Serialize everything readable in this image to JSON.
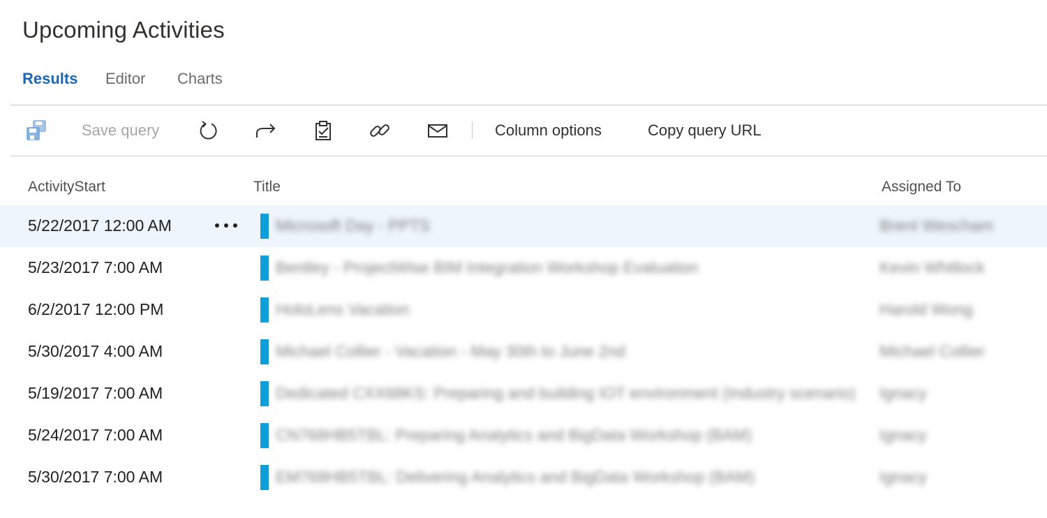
{
  "page": {
    "title": "Upcoming Activities"
  },
  "tabs": [
    {
      "label": "Results",
      "active": true
    },
    {
      "label": "Editor",
      "active": false
    },
    {
      "label": "Charts",
      "active": false
    }
  ],
  "toolbar": {
    "save_icon": "save-query-icon",
    "save_query_label": "Save query",
    "refresh_icon": "refresh-icon",
    "forward_icon": "forward-icon",
    "clipboard_icon": "clipboard-check-icon",
    "link_icon": "link-icon",
    "mail_icon": "mail-icon",
    "column_options_label": "Column options",
    "copy_query_url_label": "Copy query URL"
  },
  "grid": {
    "columns": [
      "ActivityStart",
      "Title",
      "Assigned To"
    ],
    "rows": [
      {
        "activity_start": "5/22/2017 12:00 AM",
        "title": "Microsoft Day - PPTS",
        "assigned_to": "Brent Wescham",
        "selected": true
      },
      {
        "activity_start": "5/23/2017 7:00 AM",
        "title": "Bentley - ProjectWise BIM Integration Workshop Evaluation",
        "assigned_to": "Kevin Whitlock",
        "selected": false
      },
      {
        "activity_start": "6/2/2017 12:00 PM",
        "title": "HoloLens Vacation",
        "assigned_to": "Harold Wong",
        "selected": false
      },
      {
        "activity_start": "5/30/2017 4:00 AM",
        "title": "Michael Collier - Vacation - May 30th to June 2nd",
        "assigned_to": "Michael Collier",
        "selected": false
      },
      {
        "activity_start": "5/19/2017 7:00 AM",
        "title": "Dedicated CXX68KS: Preparing and building IOT environment (Industry scenario)",
        "assigned_to": "Ignacy",
        "selected": false
      },
      {
        "activity_start": "5/24/2017 7:00 AM",
        "title": "CN768HB5TBL: Preparing Analytics and BigData Workshop (BAM)",
        "assigned_to": "Ignacy",
        "selected": false
      },
      {
        "activity_start": "5/30/2017 7:00 AM",
        "title": "EM768HB5TBL: Delivering Analytics and BigData Workshop (BAM)",
        "assigned_to": "Ignacy",
        "selected": false
      }
    ]
  },
  "colors": {
    "accent": "#1a66b7",
    "type_bar": "#0e9fd8",
    "selected_row": "#eef5fc"
  }
}
